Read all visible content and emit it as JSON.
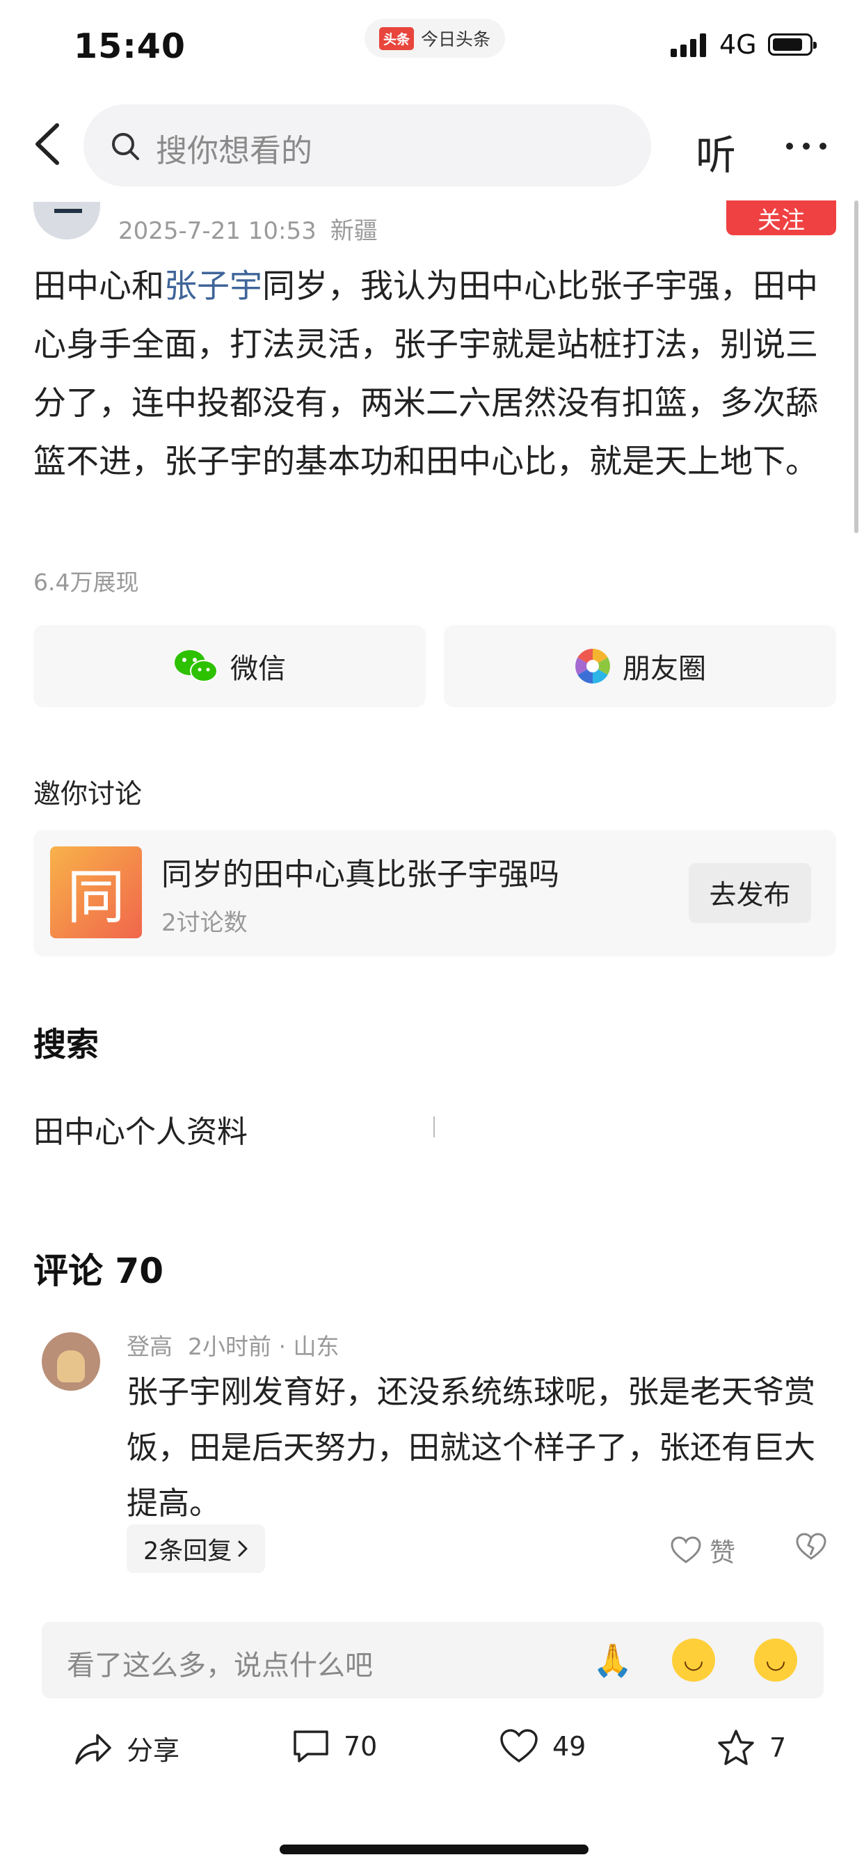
{
  "status_bar": {
    "time": "15:40",
    "app_badge_logo": "头条",
    "app_badge_text": "今日头条",
    "network": "4G"
  },
  "nav": {
    "search_placeholder": "搜你想看的",
    "listen_label": "听"
  },
  "post": {
    "date": "2025-7-21 10:53",
    "location": "新疆",
    "follow_label": "关注",
    "body_parts": [
      "田中心和",
      "张子宇",
      "同岁，我认为田中心比张子宇强，田中心身手全面，打法灵活，张子宇就是站桩打法，别说三分了，连中投都没有，两米二六居然没有扣篮，多次舔篮不进，张子宇的基本功和田中心比，就是天上地下。"
    ],
    "views": "6.4万展现"
  },
  "share": {
    "wechat_label": "微信",
    "moments_label": "朋友圈"
  },
  "invite": {
    "heading": "邀你讨论",
    "topic_icon_char": "同",
    "topic_title": "同岁的田中心真比张子宇强吗",
    "topic_count": "2讨论数",
    "publish_label": "去发布"
  },
  "search_section": {
    "heading": "搜索",
    "item": "田中心个人资料"
  },
  "comments": {
    "heading": "评论 70",
    "items": [
      {
        "user": "登高",
        "time": "2小时前 · 山东",
        "text": "张子宇刚发育好，还没系统练球呢，张是老天爷赏饭，田是后天努力，田就这个样子了，张还有巨大提高。",
        "replies_label": "2条回复",
        "like_label": "赞"
      }
    ]
  },
  "input_bar": {
    "placeholder": "看了这么多，说点什么吧"
  },
  "actions": {
    "share_label": "分享",
    "comment_count": "70",
    "like_count": "49",
    "fav_count": "7"
  },
  "colors": {
    "accent_red": "#f04142",
    "mention_blue": "#406599"
  }
}
